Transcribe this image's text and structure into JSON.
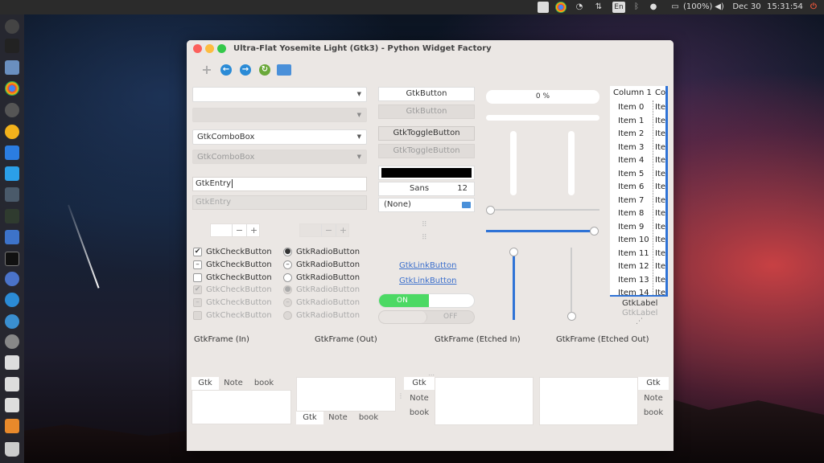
{
  "top_panel": {
    "keyboard": "En",
    "battery": "(100%)",
    "date": "Dec 30",
    "time": "15:31:54"
  },
  "window": {
    "title": "Ultra-Flat Yosemite Light (Gtk3) - Python Widget Factory"
  },
  "combos": {
    "combo3": "GtkComboBox",
    "combo4": "GtkComboBox"
  },
  "entries": {
    "entry1": "GtkEntry",
    "entry2_placeholder": "GtkEntry"
  },
  "checks": [
    {
      "label": "GtkCheckButton",
      "state": "✔"
    },
    {
      "label": "GtkCheckButton",
      "state": "–"
    },
    {
      "label": "GtkCheckButton",
      "state": ""
    },
    {
      "label": "GtkCheckButton",
      "state": "✔"
    },
    {
      "label": "GtkCheckButton",
      "state": "–"
    },
    {
      "label": "GtkCheckButton",
      "state": ""
    }
  ],
  "radios": [
    {
      "label": "GtkRadioButton",
      "state": "●"
    },
    {
      "label": "GtkRadioButton",
      "state": "–"
    },
    {
      "label": "GtkRadioButton",
      "state": ""
    },
    {
      "label": "GtkRadioButton",
      "state": "●"
    },
    {
      "label": "GtkRadioButton",
      "state": "–"
    },
    {
      "label": "GtkRadioButton",
      "state": ""
    }
  ],
  "buttons": {
    "button1": "GtkButton",
    "button2": "GtkButton",
    "toggle1": "GtkToggleButton",
    "toggle2": "GtkToggleButton"
  },
  "font_button": {
    "family": "Sans",
    "size": "12"
  },
  "file_chooser": {
    "value": "(None)"
  },
  "links": [
    "GtkLinkButton",
    "GtkLinkButton"
  ],
  "switches": {
    "on": "ON",
    "off": "OFF"
  },
  "progress": {
    "label": "0 %",
    "value": 0
  },
  "tree": {
    "columns": [
      "Column 1",
      "Co"
    ],
    "items": [
      "Item 0",
      "Item 1",
      "Item 2",
      "Item 3",
      "Item 4",
      "Item 5",
      "Item 6",
      "Item 7",
      "Item 8",
      "Item 9",
      "Item 10",
      "Item 11",
      "Item 12",
      "Item 13",
      "Item 14"
    ],
    "col2_prefix": "Ite"
  },
  "labels": {
    "label1": "GtkLabel",
    "label2": "GtkLabel"
  },
  "frames": [
    "GtkFrame (In)",
    "GtkFrame (Out)",
    "GtkFrame (Etched In)",
    "GtkFrame (Etched Out)"
  ],
  "notebook_tabs": [
    "Gtk",
    "Note",
    "book"
  ],
  "colors": {
    "accent": "#2f73d6",
    "switch_on": "#4cd964",
    "window_bg": "#ebe7e4"
  }
}
